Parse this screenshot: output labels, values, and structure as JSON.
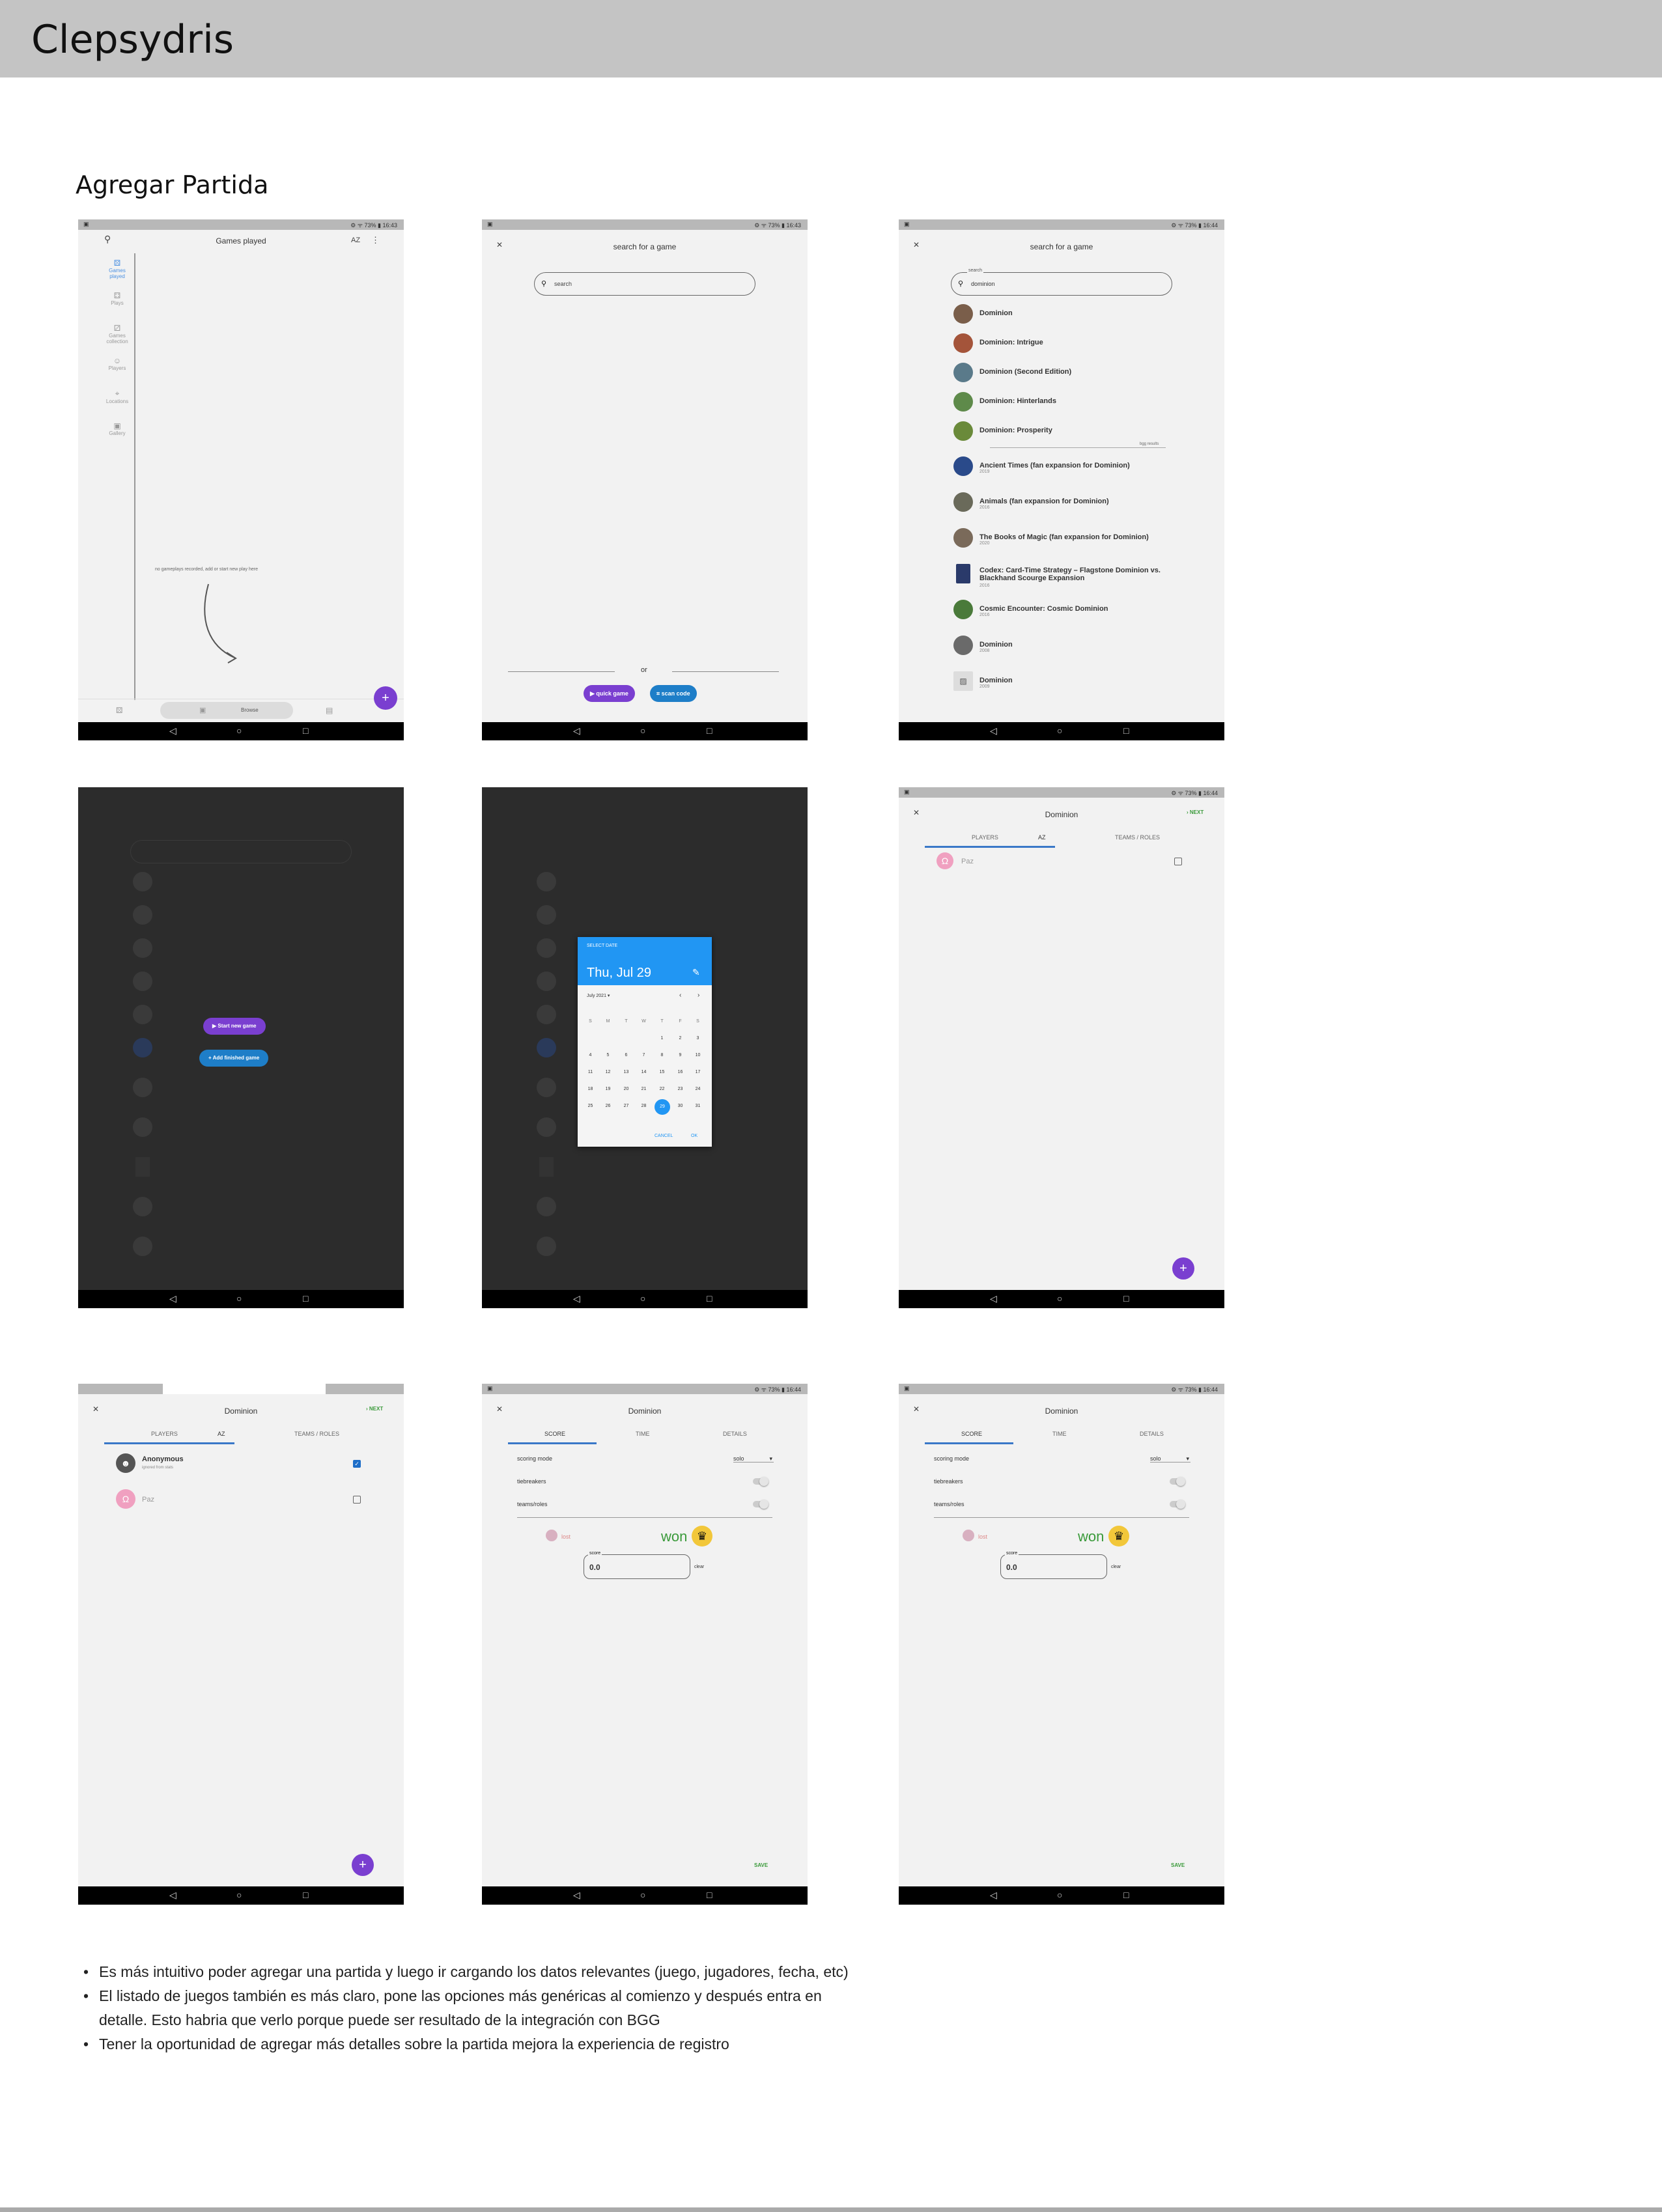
{
  "header": {
    "title": "Clepsydris"
  },
  "section": {
    "title": "Agregar Partida"
  },
  "status": {
    "left": "▣",
    "right": "⚙ ᯤ 73% ▮ 16:43",
    "right2": "⚙ ᯤ 73% ▮ 16:43",
    "right3": "⚙ ᯤ 73% ▮ 16:44"
  },
  "nav": {
    "back": "◁",
    "home": "○",
    "recent": "□"
  },
  "screen1": {
    "title": "Games played",
    "sort": "AZ",
    "more": "⋮",
    "search_icon": "⚲",
    "rail": [
      "Games played",
      "Plays",
      "Games collection",
      "Players",
      "Locations",
      "Gallery"
    ],
    "empty": "no gameplays recorded, add or start new play here",
    "bottom_tab": "Browse",
    "fab": "+"
  },
  "screen2": {
    "title": "search for a game",
    "close": "✕",
    "search_placeholder": "search",
    "or": "or",
    "quick": "quick game",
    "scan": "scan code"
  },
  "screen3": {
    "title": "search for a game",
    "search_label": "search",
    "search_value": "dominion",
    "bgg": "bgg results",
    "items": [
      {
        "name": "Dominion",
        "year": ""
      },
      {
        "name": "Dominion: Intrigue",
        "year": ""
      },
      {
        "name": "Dominion (Second Edition)",
        "year": ""
      },
      {
        "name": "Dominion: Hinterlands",
        "year": ""
      },
      {
        "name": "Dominion: Prosperity",
        "year": ""
      },
      {
        "name": "Ancient Times (fan expansion for Dominion)",
        "year": "2019"
      },
      {
        "name": "Animals (fan expansion for Dominion)",
        "year": "2016"
      },
      {
        "name": "The Books of Magic (fan expansion for Dominion)",
        "year": "2020"
      },
      {
        "name": "Codex: Card-Time Strategy – Flagstone Dominion vs. Blackhand Scourge Expansion",
        "year": "2016"
      },
      {
        "name": "Cosmic Encounter: Cosmic Dominion",
        "year": "2016"
      },
      {
        "name": "Dominion",
        "year": "2008"
      },
      {
        "name": "Dominion",
        "year": "2009"
      }
    ]
  },
  "screen4": {
    "start": "Start new game",
    "add": "Add finished game"
  },
  "screen5": {
    "select_label": "SELECT DATE",
    "date": "Thu, Jul 29",
    "month": "July 2021",
    "weekdays": [
      "S",
      "M",
      "T",
      "W",
      "T",
      "F",
      "S"
    ],
    "days": [
      "1",
      "2",
      "3",
      "4",
      "5",
      "6",
      "7",
      "8",
      "9",
      "10",
      "11",
      "12",
      "13",
      "14",
      "15",
      "16",
      "17",
      "18",
      "19",
      "20",
      "21",
      "22",
      "23",
      "24",
      "25",
      "26",
      "27",
      "28",
      "29",
      "30",
      "31"
    ],
    "selected": "29",
    "cancel": "CANCEL",
    "ok": "OK"
  },
  "screen6": {
    "title": "Dominion",
    "next": "NEXT",
    "tab_players": "PLAYERS",
    "tab_az": "AZ",
    "tab_teams": "TEAMS / ROLES",
    "player": "Paz"
  },
  "screen7": {
    "title": "Dominion",
    "next": "NEXT",
    "tab_players": "PLAYERS",
    "tab_az": "AZ",
    "tab_teams": "TEAMS / ROLES",
    "p1": "Anonymous",
    "p1_sub": "ignored from stats",
    "p2": "Paz"
  },
  "screen8": {
    "title": "Dominion",
    "tab_score": "SCORE",
    "tab_time": "TIME",
    "tab_details": "DETAILS",
    "scoring": "scoring mode",
    "solo": "solo",
    "tiebreakers": "tiebreakers",
    "teams": "teams/roles",
    "lost": "lost",
    "won": "won",
    "score_label": "score",
    "score_value": "0.0",
    "clear": "clear",
    "save": "SAVE"
  },
  "notes": [
    "Es más intuitivo poder agregar una partida y luego ir cargando los datos relevantes (juego, jugadores, fecha, etc)",
    "El listado de juegos también es más claro, pone las opciones más genéricas al comienzo y después entra en detalle. Esto habria que verlo porque puede ser resultado de la integración con BGG",
    "Tener la oportunidad de agregar más detalles sobre la partida mejora la experiencia de registro"
  ]
}
